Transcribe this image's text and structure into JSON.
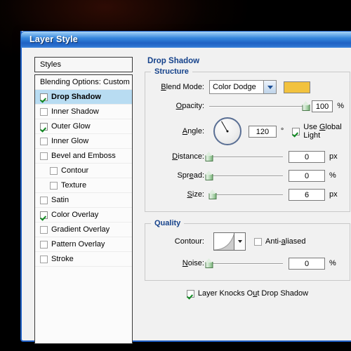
{
  "window": {
    "title": "Layer Style"
  },
  "styles_panel": {
    "header": "Styles",
    "items": [
      {
        "label": "Blending Options: Custom",
        "checkbox": "none",
        "checked": false,
        "selected": false,
        "indent": false
      },
      {
        "label": "Drop Shadow",
        "checkbox": "show",
        "checked": true,
        "selected": true,
        "indent": false
      },
      {
        "label": "Inner Shadow",
        "checkbox": "show",
        "checked": false,
        "selected": false,
        "indent": false
      },
      {
        "label": "Outer Glow",
        "checkbox": "show",
        "checked": true,
        "selected": false,
        "indent": false
      },
      {
        "label": "Inner Glow",
        "checkbox": "show",
        "checked": false,
        "selected": false,
        "indent": false
      },
      {
        "label": "Bevel and Emboss",
        "checkbox": "show",
        "checked": false,
        "selected": false,
        "indent": false
      },
      {
        "label": "Contour",
        "checkbox": "show",
        "checked": false,
        "selected": false,
        "indent": true
      },
      {
        "label": "Texture",
        "checkbox": "show",
        "checked": false,
        "selected": false,
        "indent": true
      },
      {
        "label": "Satin",
        "checkbox": "show",
        "checked": false,
        "selected": false,
        "indent": false
      },
      {
        "label": "Color Overlay",
        "checkbox": "show",
        "checked": true,
        "selected": false,
        "indent": false
      },
      {
        "label": "Gradient Overlay",
        "checkbox": "show",
        "checked": false,
        "selected": false,
        "indent": false
      },
      {
        "label": "Pattern Overlay",
        "checkbox": "show",
        "checked": false,
        "selected": false,
        "indent": false
      },
      {
        "label": "Stroke",
        "checkbox": "show",
        "checked": false,
        "selected": false,
        "indent": false
      }
    ]
  },
  "effect": {
    "title": "Drop Shadow",
    "structure": {
      "legend": "Structure",
      "blend_mode_label": "Blend Mode:",
      "blend_mode_value": "Color Dodge",
      "shadow_color": "#f2c23e",
      "opacity_label": "Opacity:",
      "opacity_value": "100",
      "opacity_unit": "%",
      "opacity_percent": 100,
      "angle_label": "Angle:",
      "angle_value": "120",
      "angle_unit": "°",
      "use_global_light_label": "Use Global Light",
      "use_global_light_checked": true,
      "distance_label": "Distance:",
      "distance_value": "0",
      "distance_unit": "px",
      "distance_percent": 0,
      "spread_label": "Spread:",
      "spread_value": "0",
      "spread_unit": "%",
      "spread_percent": 0,
      "size_label": "Size:",
      "size_value": "6",
      "size_unit": "px",
      "size_percent": 5
    },
    "quality": {
      "legend": "Quality",
      "contour_label": "Contour:",
      "anti_aliased_label": "Anti-aliased",
      "anti_aliased_checked": false,
      "noise_label": "Noise:",
      "noise_value": "0",
      "noise_unit": "%",
      "noise_percent": 0,
      "knocks_out_label": "Layer Knocks Out Drop Shadow",
      "knocks_out_checked": true
    }
  }
}
